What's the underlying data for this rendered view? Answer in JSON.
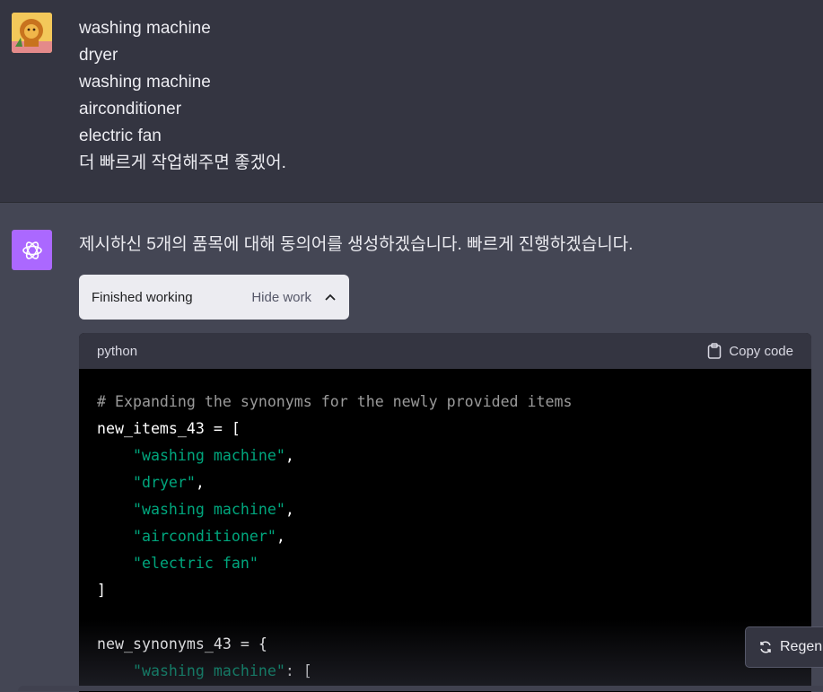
{
  "user": {
    "lines": [
      "washing machine",
      "dryer",
      "washing machine",
      "airconditioner",
      "electric fan",
      "더 빠르게 작업해주면 좋겠어."
    ]
  },
  "assistant": {
    "message": "제시하신 5개의 품목에 대해 동의어를 생성하겠습니다. 빠르게 진행하겠습니다.",
    "work_status": "Finished working",
    "hide_work_label": "Hide work",
    "code": {
      "language": "python",
      "copy_label": "Copy code",
      "comment": "# Expanding the synonyms for the newly provided items",
      "assign1": "new_items_43 = [",
      "items": [
        "\"washing machine\"",
        "\"dryer\"",
        "\"washing machine\"",
        "\"airconditioner\"",
        "\"electric fan\""
      ],
      "close1": "]",
      "assign2": "new_synonyms_43 = {",
      "key1": "\"washing machine\"",
      "key1_suffix": ": ["
    }
  },
  "regenerate_label": "Regen",
  "colors": {
    "user_bg": "#343541",
    "assistant_bg": "#444654",
    "code_string": "#00a67d",
    "gpt_icon_bg": "#ab68ff"
  }
}
